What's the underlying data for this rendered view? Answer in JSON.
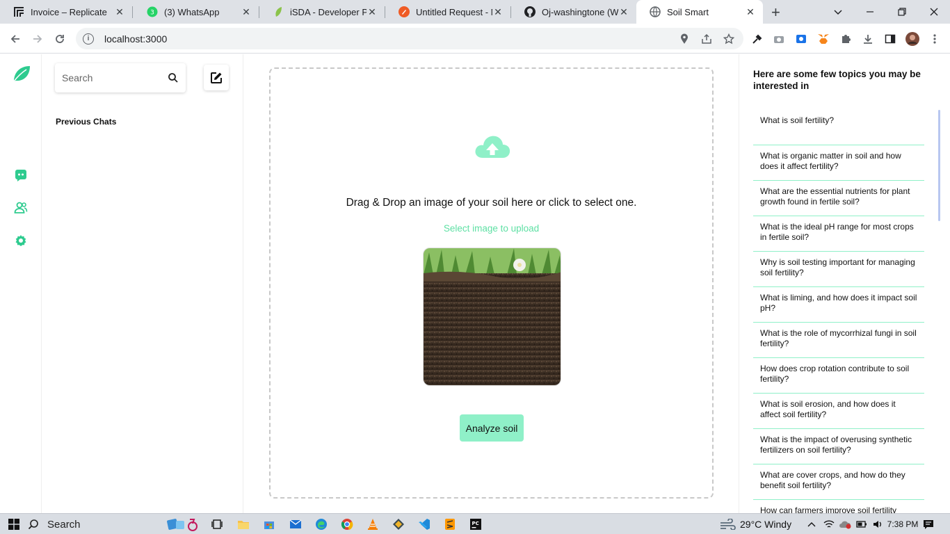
{
  "browser": {
    "tabs": [
      {
        "title": "Invoice – Replicate",
        "active": false
      },
      {
        "title": "(3) WhatsApp",
        "active": false
      },
      {
        "title": "iSDA - Developer Por",
        "active": false
      },
      {
        "title": "Untitled Request - M",
        "active": false
      },
      {
        "title": "Oj-washingtone (Was",
        "active": false
      },
      {
        "title": "Soil Smart",
        "active": true
      }
    ],
    "url": "localhost:3000"
  },
  "sidebar": {
    "search_placeholder": "Search",
    "previous_chats_label": "Previous Chats"
  },
  "upload": {
    "instruction": "Drag & Drop an image of your soil here or click to select one.",
    "select_link": "Select image to upload",
    "analyze_button": "Analyze soil"
  },
  "topics": {
    "title": "Here are some few topics you may be interested in",
    "items": [
      "What is soil fertility?",
      "What is organic matter in soil and how does it affect fertility?",
      "What are the essential nutrients for plant growth found in fertile soil?",
      "What is the ideal pH range for most crops in fertile soil?",
      "Why is soil testing important for managing soil fertility?",
      "What is liming, and how does it impact soil pH?",
      "What is the role of mycorrhizal fungi in soil fertility?",
      "How does crop rotation contribute to soil fertility?",
      "What is soil erosion, and how does it affect soil fertility?",
      "What is the impact of overusing synthetic fertilizers on soil fertility?",
      "What are cover crops, and how do they benefit soil fertility?",
      "How can farmers improve soil fertility through crop residue management?"
    ]
  },
  "taskbar": {
    "search_label": "Search",
    "weather": "29°C  Windy",
    "time": "7:38 PM"
  },
  "colors": {
    "accent": "#5ee0a4",
    "accent_light": "#8ff0c8",
    "rail_icon": "#2ecb8f"
  }
}
